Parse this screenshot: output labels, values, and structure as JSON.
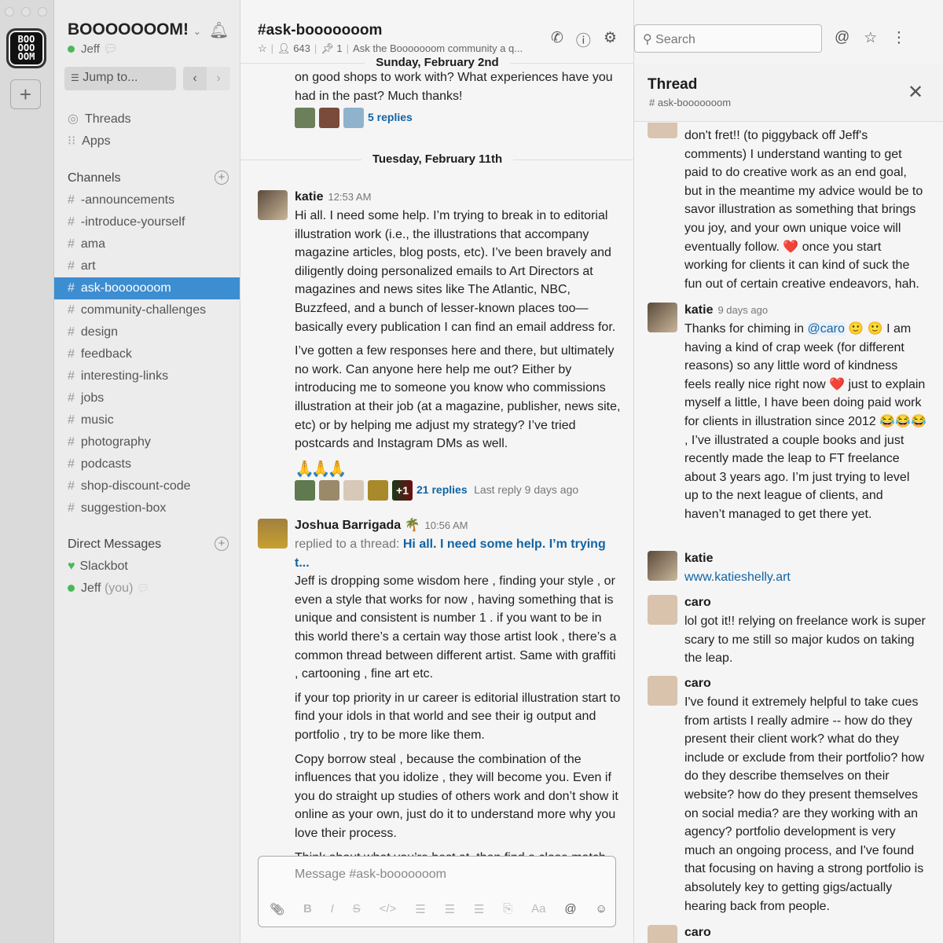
{
  "workspace": {
    "logo_text": "BOO OOO OOM",
    "name": "BOOOOOOOM!",
    "user": "Jeff",
    "jump_to": "Jump to..."
  },
  "sidebar": {
    "nav": [
      "Threads",
      "Apps"
    ],
    "channels_header": "Channels",
    "channels": [
      "-announcements",
      "-introduce-yourself",
      "ama",
      "art",
      "ask-booooooom",
      "community-challenges",
      "design",
      "feedback",
      "interesting-links",
      "jobs",
      "music",
      "photography",
      "podcasts",
      "shop-discount-code",
      "suggestion-box"
    ],
    "selected_channel": "ask-booooooom",
    "dm_header": "Direct Messages",
    "dms": [
      {
        "name": "Slackbot",
        "suffix": ""
      },
      {
        "name": "Jeff",
        "suffix": "(you)"
      }
    ]
  },
  "channel": {
    "title": "#ask-booooooom",
    "members": "643",
    "pins": "1",
    "topic": "Ask the Booooooom community a q..."
  },
  "search": {
    "placeholder": "Search"
  },
  "colors": {
    "selected": "#3d8dd1",
    "link": "#1264a3",
    "online": "#4ab85a"
  },
  "messages": {
    "date_top": "Sunday, February 2nd",
    "prev_tail": "on good shops to work with? What experiences have you had in the past? Much thanks!",
    "prev_replies": "5 replies",
    "date2": "Tuesday, February 11th",
    "katie": {
      "name": "katie",
      "time": "12:53 AM",
      "paragraphs": [
        "Hi all. I need some help. I’m trying to break in to editorial illustration work (i.e., the illustrations that accompany magazine articles, blog posts, etc). I’ve been bravely and diligently doing personalized emails to Art Directors at magazines and news sites like The Atlantic, NBC, Buzzfeed, and a bunch of lesser-known places too—basically every publication I can find an email address for.",
        "I’ve gotten a few responses here and there, but ultimately no work. Can anyone here help me out? Either by introducing me to someone you know who commissions illustration at their job (at a magazine, publisher, news site, etc) or by helping me adjust my strategy? I’ve tried postcards and Instagram DMs as well."
      ],
      "reactions": "🙏🙏🙏",
      "more": "+1",
      "replies": "21 replies",
      "last_reply": "Last reply 9 days ago"
    },
    "joshua": {
      "name": "Joshua Barrigada",
      "emoji": "🌴",
      "time": "10:56 AM",
      "replied_prefix": "replied to a thread:",
      "replied_link": "Hi all. I need some help. I’m trying t...",
      "paragraphs": [
        "Jeff is dropping some wisdom here , finding your style , or even a style that works for now  , having something that is unique and consistent is  number 1 .  if you want to be in this world there’s a certain way those artist look , there’s a common thread between different artist. Same with graffiti , cartooning , fine art etc.",
        "if your top priority in ur career is editorial illustration start to find your idols in that world and see their ig output and portfolio , try to be more like them.",
        "Copy borrow steal , because the combination of the influences that you idolize , they will become you. Even if you do straight up studies of others work and don’t show it online as your own, just do it to understand more why you love their process.",
        "Think about what you’re best at, then find a close match"
      ]
    }
  },
  "composer": {
    "placeholder": "Message #ask-booooooom"
  },
  "thread": {
    "title": "Thread",
    "channel": "# ask-booooooom",
    "items": [
      {
        "name": "",
        "meta": "",
        "text": "don't fret!! (to piggyback off Jeff's comments) I understand wanting to get paid to do creative work as an end goal, but in the meantime my advice would be to savor illustration as something that brings you joy, and your own unique voice will eventually follow. ❤️ once you start working for clients it can kind of suck the fun out of certain creative endeavors, hah."
      },
      {
        "name": "katie",
        "meta": "9 days ago",
        "pre": "Thanks for chiming in ",
        "mention": "@caro",
        "text": " 🙂 🙂 I am having a kind of crap week (for different reasons) so any little word of kindness feels really nice right now ❤️ just to explain myself a little, I have been doing paid work for clients in illustration since 2012 😂😂😂 , I’ve illustrated a couple books and just recently made the leap to FT freelance about 3 years ago. I’m just trying to level up to the next league of clients, and haven’t managed to get there yet."
      },
      {
        "name": "katie",
        "meta": "",
        "link": "www.katieshelly.art"
      },
      {
        "name": "caro",
        "meta": "",
        "text": "lol got it!! relying on freelance work is super scary to me still so major kudos on taking the leap."
      },
      {
        "name": "caro",
        "meta": "",
        "text": "I've found it extremely helpful to take cues from artists I really admire -- how do they present their client work? what do they include or exclude from their portfolio? how do they describe themselves on their website? how do they present themselves on social media? are they working with an agency? portfolio development is very much an ongoing process, and I've found that focusing on having a strong portfolio is absolutely key to getting gigs/actually hearing back from people."
      },
      {
        "name": "caro",
        "meta": "",
        "text": ""
      }
    ]
  }
}
